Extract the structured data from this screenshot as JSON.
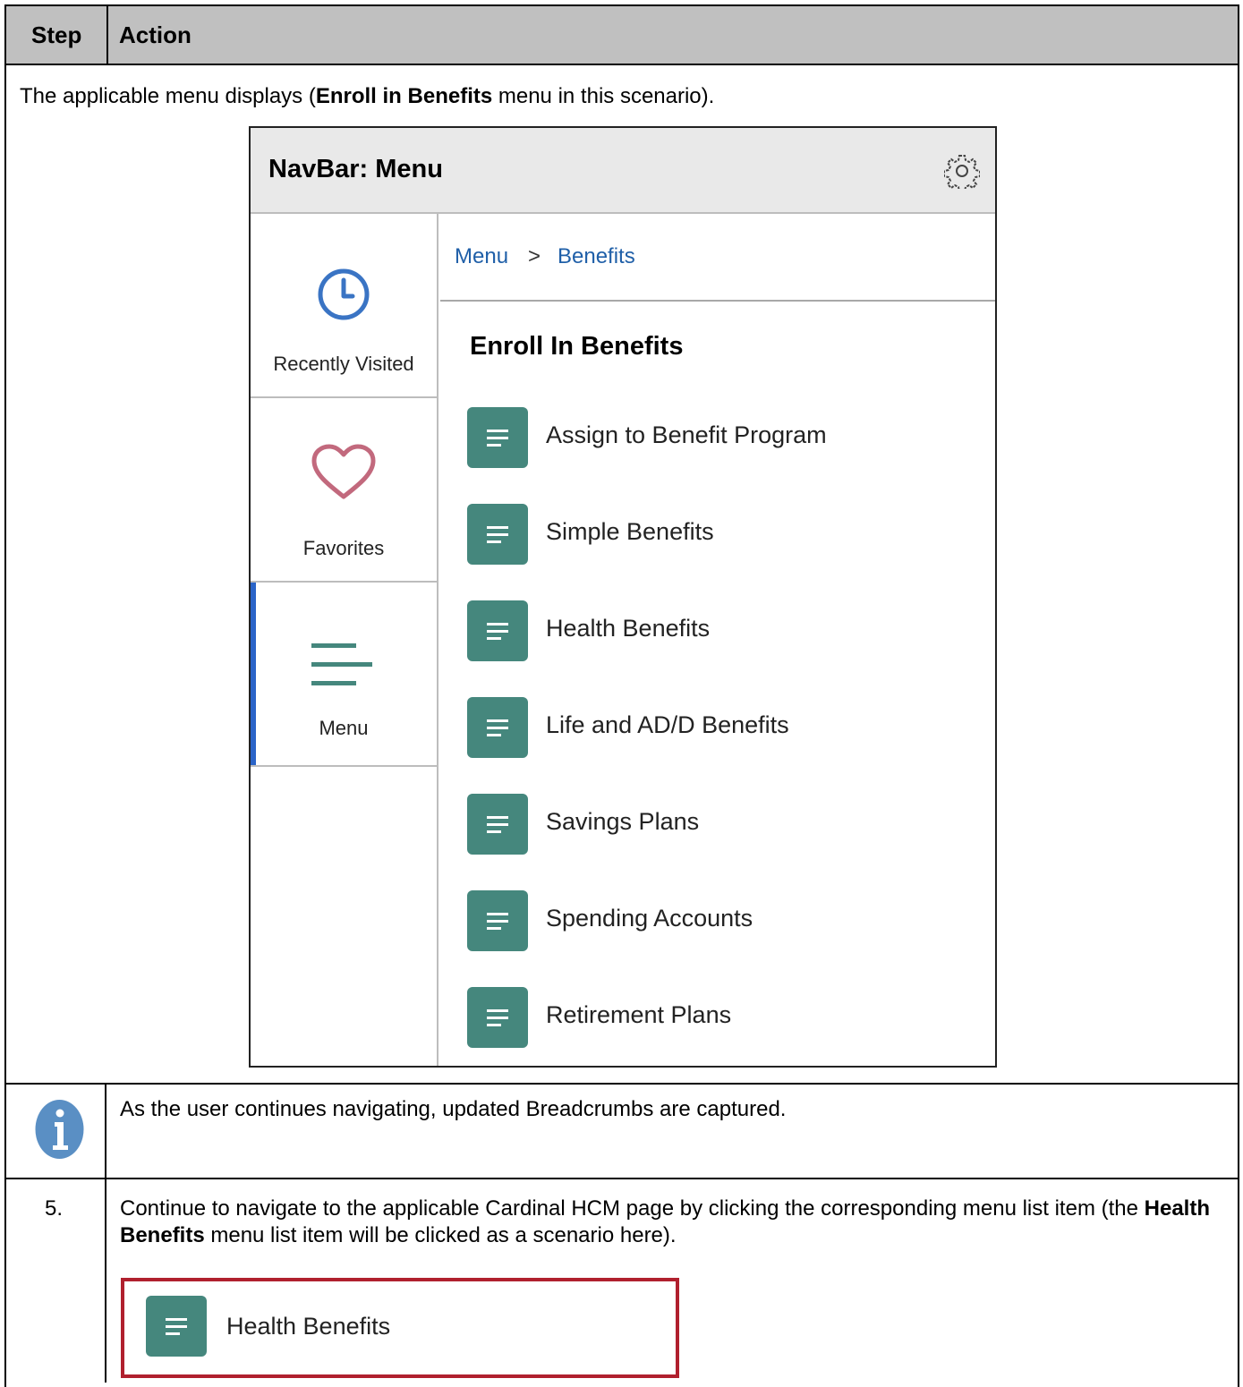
{
  "header": {
    "step": "Step",
    "action": "Action"
  },
  "intro": {
    "pre": "The applicable menu displays (",
    "bold": "Enroll in Benefits",
    "post": " menu in this scenario)."
  },
  "navbar": {
    "title": "NavBar: Menu",
    "settings_icon": "gear-icon",
    "side": [
      {
        "label": "Recently Visited",
        "icon": "clock-icon"
      },
      {
        "label": "Favorites",
        "icon": "heart-icon"
      },
      {
        "label": "Menu",
        "icon": "menu-lines-icon",
        "active": true
      }
    ],
    "breadcrumbs": [
      "Menu",
      "Benefits"
    ],
    "breadcrumb_separator": ">",
    "menu_title": "Enroll In Benefits",
    "items": [
      "Assign to Benefit Program",
      "Simple Benefits",
      "Health Benefits",
      "Life and AD/D Benefits",
      "Savings Plans",
      "Spending Accounts",
      "Retirement Plans"
    ]
  },
  "note": {
    "icon": "info-icon",
    "text": "As the user continues navigating, updated Breadcrumbs are captured."
  },
  "step5": {
    "number": "5.",
    "pre": "Continue to navigate to the applicable Cardinal HCM page by clicking the corresponding menu list item (the ",
    "bold": "Health Benefits",
    "post": " menu list item will be clicked as a scenario here).",
    "callout_label": "Health Benefits"
  },
  "colors": {
    "accent_teal": "#45877d",
    "header_gray": "#c0c0c0",
    "link_blue": "#1f5fa8",
    "callout_red": "#b0202e",
    "info_blue": "#5a8fc4",
    "favorites_pink": "#c2697d",
    "active_bar": "#2a64c8"
  }
}
